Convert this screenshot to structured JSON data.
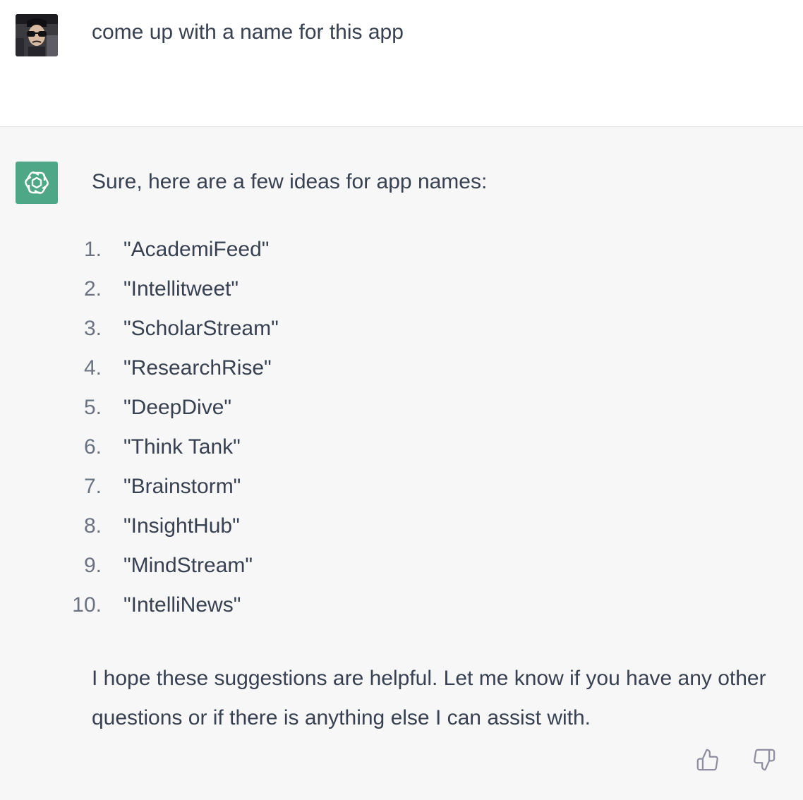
{
  "conversation": {
    "user_message": {
      "avatar_icon": "user-avatar-photo",
      "text": "come up with a name for this app"
    },
    "assistant_message": {
      "avatar_icon": "chatgpt-logo-icon",
      "avatar_color": "#4ea786",
      "intro": "Sure, here are a few ideas for app names:",
      "list": [
        {
          "number": "1.",
          "name": "\"AcademiFeed\""
        },
        {
          "number": "2.",
          "name": "\"Intellitweet\""
        },
        {
          "number": "3.",
          "name": "\"ScholarStream\""
        },
        {
          "number": "4.",
          "name": "\"ResearchRise\""
        },
        {
          "number": "5.",
          "name": "\"DeepDive\""
        },
        {
          "number": "6.",
          "name": "\"Think Tank\""
        },
        {
          "number": "7.",
          "name": "\"Brainstorm\""
        },
        {
          "number": "8.",
          "name": "\"InsightHub\""
        },
        {
          "number": "9.",
          "name": "\"MindStream\""
        },
        {
          "number": "10.",
          "name": "\"IntelliNews\""
        }
      ],
      "closing": "I hope these suggestions are helpful. Let me know if you have any other questions or if there is anything else I can assist with.",
      "feedback": {
        "like_icon": "thumbs-up-icon",
        "dislike_icon": "thumbs-down-icon"
      }
    }
  },
  "colors": {
    "user_bg": "#ffffff",
    "assistant_bg": "#f7f7f8",
    "text": "#374151",
    "list_number": "#6b7280"
  }
}
